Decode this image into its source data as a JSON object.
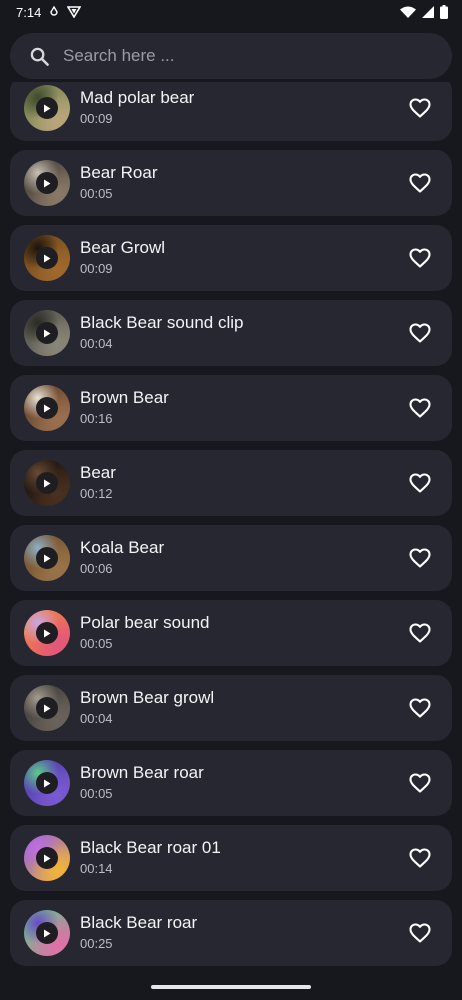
{
  "status_bar": {
    "time": "7:14"
  },
  "search": {
    "placeholder": "Search here ..."
  },
  "sounds": [
    {
      "title": "Mad polar bear",
      "duration": "00:09",
      "thumb": "photo-bear-grass",
      "colors": [
        "#6b7a4a",
        "#b9a77a",
        "#3e4a2c"
      ]
    },
    {
      "title": "Bear Roar",
      "duration": "00:05",
      "thumb": "photo-bear-roar",
      "colors": [
        "#3a3530",
        "#8a7a68",
        "#c9c0b4"
      ]
    },
    {
      "title": "Bear Growl",
      "duration": "00:09",
      "thumb": "photo-brown-bear",
      "colors": [
        "#6a4418",
        "#a0692d",
        "#1a140e"
      ]
    },
    {
      "title": "Black Bear sound clip",
      "duration": "00:04",
      "thumb": "photo-black-bear",
      "colors": [
        "#4a4a42",
        "#8a8678",
        "#2a2a26"
      ]
    },
    {
      "title": "Brown Bear",
      "duration": "00:16",
      "thumb": "photo-brown-bear-snow",
      "colors": [
        "#5a3a22",
        "#9b7050",
        "#e8e2d8"
      ]
    },
    {
      "title": "Bear",
      "duration": "00:12",
      "thumb": "photo-bear-dark",
      "colors": [
        "#120e0c",
        "#4a3020",
        "#6a4a34"
      ]
    },
    {
      "title": "Koala Bear",
      "duration": "00:06",
      "thumb": "photo-bear-sky",
      "colors": [
        "#6a4a2a",
        "#9a7448",
        "#8fb0c6"
      ]
    },
    {
      "title": "Polar bear sound",
      "duration": "00:05",
      "thumb": "abstract-orange-pink",
      "colors": [
        "#f08a3a",
        "#e4567a",
        "#c8a6e6"
      ]
    },
    {
      "title": "Brown Bear growl",
      "duration": "00:04",
      "thumb": "photo-bear-gray",
      "colors": [
        "#3a3632",
        "#6a645c",
        "#a49c90"
      ]
    },
    {
      "title": "Brown Bear roar",
      "duration": "00:05",
      "thumb": "abstract-purple-green",
      "colors": [
        "#4a3aa8",
        "#7a5ad0",
        "#5ec98a"
      ]
    },
    {
      "title": "Black Bear roar 01",
      "duration": "00:14",
      "thumb": "abstract-violet-gold",
      "colors": [
        "#8a5ae0",
        "#f2b43a",
        "#c070e0"
      ]
    },
    {
      "title": "Black Bear roar",
      "duration": "00:25",
      "thumb": "abstract-green-pink",
      "colors": [
        "#5ac88a",
        "#e070a8",
        "#6a4ac8"
      ]
    }
  ],
  "icons": {
    "search": "search-icon",
    "play": "play-icon",
    "favorite": "heart-outline-icon",
    "wifi": "wifi-icon",
    "signal": "signal-icon",
    "battery": "battery-icon"
  },
  "colors": {
    "background": "#17181d",
    "card": "#262731",
    "text_primary": "#f4f4f6",
    "text_secondary": "#bdbdc6"
  }
}
